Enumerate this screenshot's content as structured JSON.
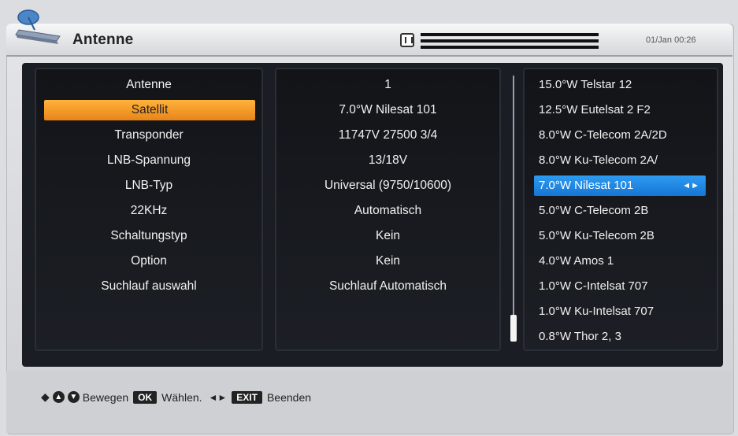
{
  "header": {
    "title": "Antenne",
    "datetime": "01/Jan 00:26"
  },
  "settings": {
    "labels": [
      "Antenne",
      "Satellit",
      "Transponder",
      "LNB-Spannung",
      "LNB-Typ",
      "22KHz",
      "Schaltungstyp",
      "Option",
      "Suchlauf auswahl"
    ],
    "values": [
      "1",
      "7.0°W Nilesat 101",
      "11747V 27500 3/4",
      "13/18V",
      "Universal (9750/10600)",
      "Automatisch",
      "Kein",
      "Kein",
      "Suchlauf Automatisch"
    ],
    "selected_index": 1
  },
  "satellites": {
    "items": [
      "15.0°W Telstar 12",
      "12.5°W Eutelsat 2 F2",
      "8.0°W C-Telecom 2A/2D",
      "8.0°W Ku-Telecom 2A/",
      "7.0°W Nilesat 101",
      "5.0°W C-Telecom 2B",
      "5.0°W Ku-Telecom 2B",
      "4.0°W Amos 1",
      "1.0°W C-Intelsat 707",
      "1.0°W Ku-Intelsat 707",
      "0.8°W Thor 2, 3"
    ],
    "selected_index": 4,
    "selected_arrows": "◄►"
  },
  "footer": {
    "move_label": "Bewegen",
    "ok_key": "OK",
    "ok_label": "Wählen.",
    "exit_key": "EXIT",
    "exit_label": "Beenden"
  },
  "colors": {
    "highlight_orange": "#f0a02a",
    "highlight_blue": "#1e88e5"
  }
}
